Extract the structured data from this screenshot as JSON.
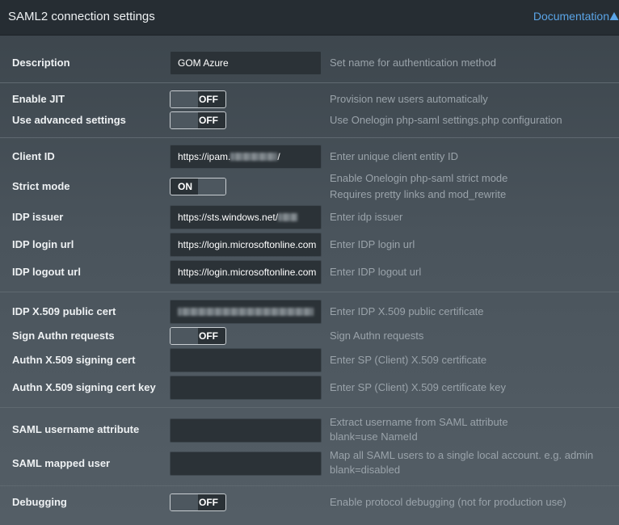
{
  "header": {
    "title": "SAML2 connection settings",
    "documentation_label": "Documentation"
  },
  "rows": {
    "description": {
      "label": "Description",
      "value": "GOM Azure",
      "hint": "Set name for authentication method"
    },
    "enable_jit": {
      "label": "Enable JIT",
      "state": "OFF",
      "hint": "Provision new users automatically"
    },
    "advanced": {
      "label": "Use advanced settings",
      "state": "OFF",
      "hint": "Use Onelogin php-saml settings.php configuration"
    },
    "client_id": {
      "label": "Client ID",
      "value": "https://ipam.",
      "value_tail": "/",
      "hint": "Enter unique client entity ID"
    },
    "strict_mode": {
      "label": "Strict mode",
      "state": "ON",
      "hint_line1": "Enable Onelogin php-saml strict mode",
      "hint_line2": "Requires pretty links and mod_rewrite"
    },
    "idp_issuer": {
      "label": "IDP issuer",
      "value": "https://sts.windows.net/",
      "hint": "Enter idp issuer"
    },
    "idp_login": {
      "label": "IDP login url",
      "value": "https://login.microsoftonline.com",
      "hint": "Enter IDP login url"
    },
    "idp_logout": {
      "label": "IDP logout url",
      "value": "https://login.microsoftonline.com",
      "hint": "Enter IDP logout url"
    },
    "idp_cert": {
      "label": "IDP X.509 public cert",
      "hint": "Enter IDP X.509 public certificate"
    },
    "sign_authn": {
      "label": "Sign Authn requests",
      "state": "OFF",
      "hint": "Sign Authn requests"
    },
    "signing_cert": {
      "label": "Authn X.509 signing cert",
      "value": "",
      "hint": "Enter SP (Client) X.509 certificate"
    },
    "signing_key": {
      "label": "Authn X.509 signing cert key",
      "value": "",
      "hint": "Enter SP (Client) X.509 certificate key"
    },
    "username_attr": {
      "label": "SAML username attribute",
      "value": "",
      "hint_line1": "Extract username from SAML attribute",
      "hint_line2": "blank=use NameId"
    },
    "mapped_user": {
      "label": "SAML mapped user",
      "value": "",
      "hint_line1": "Map all SAML users to a single local account. e.g. admin",
      "hint_line2": "blank=disabled"
    },
    "debugging": {
      "label": "Debugging",
      "state": "OFF",
      "hint": "Enable protocol debugging (not for production use)"
    }
  },
  "colors": {
    "header_bg": "#262d33",
    "link": "#5aa4e6",
    "field_bg": "#2b3237",
    "hint_text": "#9aa3aa"
  },
  "icons": {
    "documentation": "warning-triangle-icon"
  }
}
